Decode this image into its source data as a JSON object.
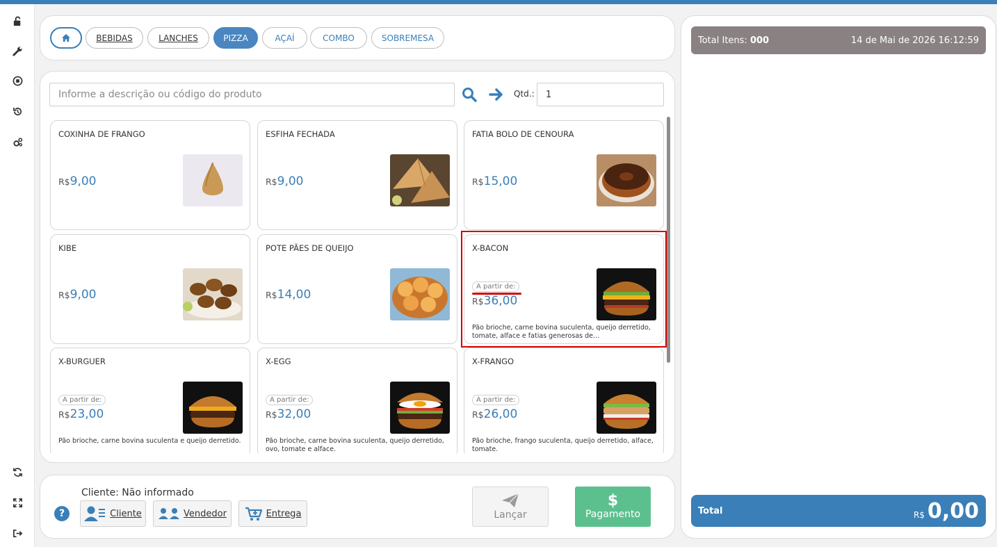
{
  "categories": [
    {
      "label": ""
    },
    {
      "label": "BEBIDAS"
    },
    {
      "label": "LANCHES"
    },
    {
      "label": "PIZZA"
    },
    {
      "label": "AÇAÍ"
    },
    {
      "label": "COMBO"
    },
    {
      "label": "SOBREMESA"
    }
  ],
  "search": {
    "placeholder": "Informe a descrição ou código do produto",
    "qtd_label": "Qtd.:",
    "qtd_value": "1"
  },
  "products": [
    {
      "name": "COXINHA DE FRANGO",
      "currency": "R$",
      "price": "9,00"
    },
    {
      "name": "ESFIHA FECHADA",
      "currency": "R$",
      "price": "9,00"
    },
    {
      "name": "FATIA BOLO DE CENOURA",
      "currency": "R$",
      "price": "15,00"
    },
    {
      "name": "KIBE",
      "currency": "R$",
      "price": "9,00"
    },
    {
      "name": "POTE PÃES DE QUEIJO",
      "currency": "R$",
      "price": "14,00"
    },
    {
      "name": "X-BACON",
      "badge": "A partir de:",
      "currency": "R$",
      "price": "36,00",
      "description": "Pão brioche, carne bovina suculenta, queijo derretido, tomate, alface e fatias generosas de..."
    },
    {
      "name": "X-BURGUER",
      "badge": "A partir de:",
      "currency": "R$",
      "price": "23,00",
      "description": "Pão brioche, carne bovina suculenta e queijo derretido."
    },
    {
      "name": "X-EGG",
      "badge": "A partir de:",
      "currency": "R$",
      "price": "32,00",
      "description": "Pão brioche, carne bovina suculenta, queijo derretido, ovo, tomate e alface."
    },
    {
      "name": "X-FRANGO",
      "badge": "A partir de:",
      "currency": "R$",
      "price": "26,00",
      "description": "Pão brioche, frango suculenta, queijo derretido, alface, tomate."
    }
  ],
  "footer": {
    "cliente_info": "Cliente: Não informado",
    "help": "?",
    "cliente_btn": "Cliente",
    "vendedor_btn": "Vendedor",
    "entrega_btn": "Entrega",
    "lancar_btn": "Lançar",
    "pagamento_icon": "$",
    "pagamento_btn": "Pagamento"
  },
  "cart": {
    "items_label": "Total Itens:",
    "items_count": "000",
    "datetime": "14 de Mai de 2026 16:12:59",
    "total_label": "Total",
    "total_currency": "R$",
    "total_value": "0,00"
  },
  "colors": {
    "primary": "#3a7fb8",
    "success": "#5cc08e",
    "header_gray": "#8a8282",
    "highlight": "#d40000"
  },
  "icons": {
    "sidebar": [
      "unlock-icon",
      "wrench-icon",
      "stop-circle-icon",
      "history-icon",
      "cogs-icon",
      "refresh-icon",
      "expand-icon",
      "logout-icon"
    ],
    "home": "home-icon",
    "search": "search-icon",
    "arrow": "arrow-right-icon"
  }
}
